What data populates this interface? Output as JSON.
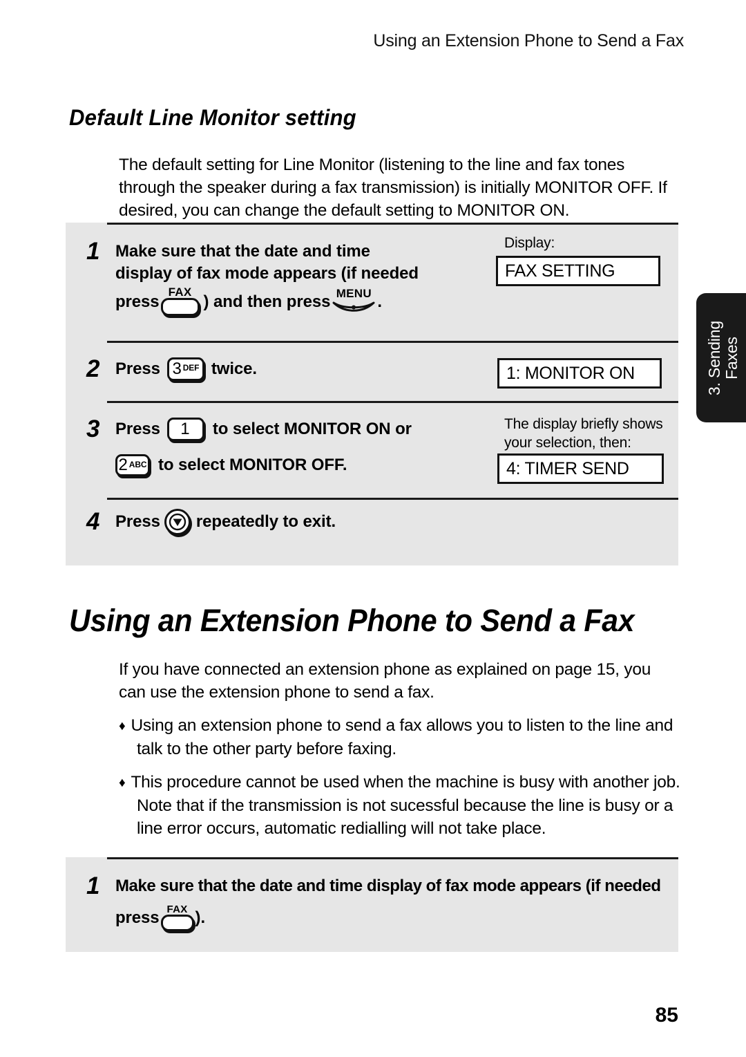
{
  "header": {
    "running_title": "Using an Extension Phone to Send a Fax"
  },
  "section": {
    "heading": "Default Line Monitor setting",
    "intro": "The default setting for Line Monitor (listening to the line and fax tones through the speaker during a fax transmission) is initially MONITOR OFF. If desired, you can change the default setting to MONITOR ON."
  },
  "procedure_top": {
    "steps": [
      {
        "number": "1",
        "line1": "Make sure that the date and time",
        "line2": "display of fax mode appears (if needed",
        "line3_pre": "press",
        "line3_mid": ") and then press",
        "line3_post": ".",
        "key_fax_label": "FAX",
        "key_menu_label": "MENU",
        "display_label": "Display:",
        "display_value": "FAX SETTING"
      },
      {
        "number": "2",
        "text_pre": "Press",
        "text_post": "twice.",
        "key_digit": "3",
        "key_sub": "DEF",
        "display_value": "1: MONITOR ON"
      },
      {
        "number": "3",
        "line1_pre": "Press",
        "line1_post": "to select MONITOR ON or",
        "line1_key_digit": "1",
        "line1_key_sub": "",
        "line2_post": "to select MONITOR OFF.",
        "line2_key_digit": "2",
        "line2_key_sub": "ABC",
        "display_label": "The display briefly shows\nyour selection, then:",
        "display_value": "4: TIMER SEND"
      },
      {
        "number": "4",
        "text_pre": "Press",
        "text_post": "repeatedly to exit.",
        "key_icon": "stop-key-icon"
      }
    ]
  },
  "chapter": {
    "heading": "Using an Extension Phone to Send a Fax",
    "intro": "If you have connected an extension phone as explained on page 15, you can use the extension phone to send a fax.",
    "bullet_glyph": "♦",
    "bullets": [
      "Using an extension phone to send a fax allows you to listen to the line and talk to the other party before faxing.",
      "This procedure cannot be used when the machine is busy with another job. Note that if the transmission is not sucessful because the line is busy or a line error occurs, automatic redialling will not take place."
    ]
  },
  "procedure_bottom": {
    "steps": [
      {
        "number": "1",
        "line1": "Make sure that the date and time display of fax mode appears (if needed",
        "line2_pre": "press",
        "line2_post": ").",
        "key_fax_label": "FAX"
      }
    ]
  },
  "side_tab": {
    "line1": "3. Sending",
    "line2": "Faxes"
  },
  "footer": {
    "page_number": "85"
  },
  "colors": {
    "panel_bg": "#e6e6e6",
    "ink": "#111111",
    "tab_bg": "#1a1a1a",
    "lcd_bg": "#ffffff"
  }
}
